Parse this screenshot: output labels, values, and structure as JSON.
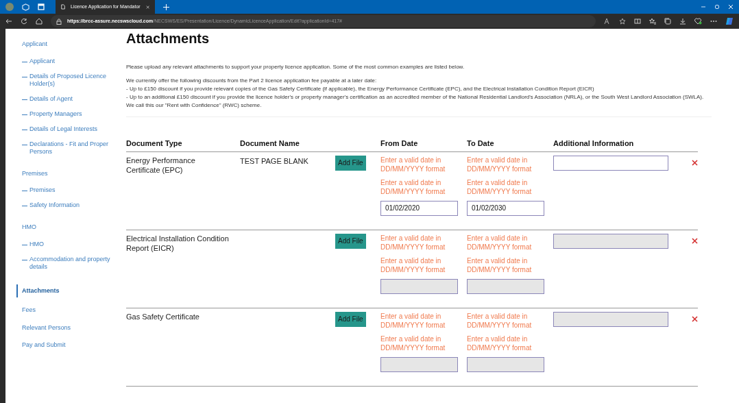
{
  "browser": {
    "tab_title": "Licence Application for Mandator",
    "url_host": "https://brcc-assure.necswscloud.com",
    "url_path": "/NECSWS/ES/Presentation/Licence/DynamicLicenceApplication/Edit?applicationId=417#"
  },
  "sidebar": {
    "items": [
      {
        "label": "Applicant",
        "selected": false,
        "children": [
          {
            "label": "Applicant",
            "selected": false
          },
          {
            "label": "Details of Proposed Licence Holder(s)",
            "selected": false
          },
          {
            "label": "Details of Agent",
            "selected": false
          },
          {
            "label": "Property Managers",
            "selected": false
          },
          {
            "label": "Details of Legal Interests",
            "selected": false
          },
          {
            "label": "Declarations - Fit and Proper Persons",
            "selected": false
          }
        ]
      },
      {
        "label": "Premises",
        "selected": false,
        "children": [
          {
            "label": "Premises",
            "selected": false
          },
          {
            "label": "Safety Information",
            "selected": false
          }
        ]
      },
      {
        "label": "HMO",
        "selected": false,
        "children": [
          {
            "label": "HMO",
            "selected": false
          },
          {
            "label": "Accommodation and property details",
            "selected": false
          }
        ]
      },
      {
        "label": "Attachments",
        "selected": true
      },
      {
        "label": "Fees",
        "selected": false
      },
      {
        "label": "Relevant Persons",
        "selected": false
      },
      {
        "label": "Pay and Submit",
        "selected": false
      }
    ]
  },
  "page": {
    "title": "Attachments",
    "intro": "Please upload any relevant attachments to support your property licence application. Some of the most common examples are listed below.",
    "discounts": [
      "We currently offer the following discounts from the Part 2 licence application fee payable at a later date:",
      "- Up to £150 discount if you provide relevant copies of the Gas Safety Certificate (if applicable), the Energy Performance Certificate (EPC), and the Electrical Installation Condition Report (EICR)",
      "- Up to an additional £150 discount if you provide the licence holder's or property manager's certification as an accredited member of the National Residential Landlord's Association (NRLA), or the South West Landlord Association (SWLA). We call this our \"Rent with Confidence\" (RWC) scheme."
    ]
  },
  "table": {
    "columns": [
      "Document Type",
      "Document Name",
      "From Date",
      "To Date",
      "Additional Information"
    ],
    "rows": [
      {
        "document_type": "Energy Performance Certificate (EPC)",
        "document_name": "TEST PAGE BLANK",
        "button": "Add File",
        "from_errors": [
          "Enter a valid date in DD/MM/YYYY format",
          "Enter a valid date in DD/MM/YYYY format"
        ],
        "to_errors": [
          "Enter a valid date in DD/MM/YYYY format",
          "Enter a valid date in DD/MM/YYYY format"
        ],
        "from_date": "01/02/2020",
        "to_date": "01/02/2030",
        "disabled": false
      },
      {
        "document_type": "Electrical Installation Condition Report (EICR)",
        "button": "Add File",
        "from_errors": [
          "Enter a valid date in DD/MM/YYYY format",
          "Enter a valid date in DD/MM/YYYY format"
        ],
        "to_errors": [
          "Enter a valid date in DD/MM/YYYY format",
          "Enter a valid date in DD/MM/YYYY format"
        ],
        "disabled": true
      },
      {
        "document_type": "Gas Safety Certificate",
        "button": "Add File",
        "from_errors": [
          "Enter a valid date in DD/MM/YYYY format",
          "Enter a valid date in DD/MM/YYYY format"
        ],
        "to_errors": [
          "Enter a valid date in DD/MM/YYYY format",
          "Enter a valid date in DD/MM/YYYY format"
        ],
        "disabled": true
      }
    ]
  }
}
